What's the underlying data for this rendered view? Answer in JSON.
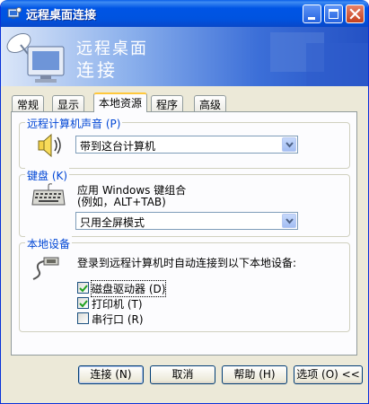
{
  "window": {
    "title": "远程桌面连接",
    "icon": "remote-desktop-icon"
  },
  "banner": {
    "line1": "远程桌面",
    "line2": "连接"
  },
  "tabs": [
    {
      "label": "常规"
    },
    {
      "label": "显示"
    },
    {
      "label": "本地资源",
      "active": true
    },
    {
      "label": "程序"
    },
    {
      "label": "高级"
    }
  ],
  "sound_group": {
    "label": "远程计算机声音 (P)",
    "icon": "speaker-icon",
    "selected": "带到这台计算机"
  },
  "keyboard_group": {
    "label": "键盘 (K)",
    "icon": "keyboard-icon",
    "desc_line1": "应用 Windows 键组合",
    "desc_line2": "(例如，ALT+TAB)",
    "selected": "只用全屏模式"
  },
  "devices_group": {
    "label": "本地设备",
    "icon": "device-plug-icon",
    "desc": "登录到远程计算机时自动连接到以下本地设备:",
    "items": [
      {
        "label": "磁盘驱动器 (D)",
        "checked": true
      },
      {
        "label": "打印机 (T)",
        "checked": true
      },
      {
        "label": "串行口 (R)",
        "checked": false
      }
    ]
  },
  "buttons": {
    "connect": "连接 (N)",
    "cancel": "取消",
    "help": "帮助 (H)",
    "options": "选项 (O) <<"
  },
  "colors": {
    "titlebar": "#0055e5",
    "group_label": "#0046d5",
    "tab_highlight": "#ffc83c"
  }
}
